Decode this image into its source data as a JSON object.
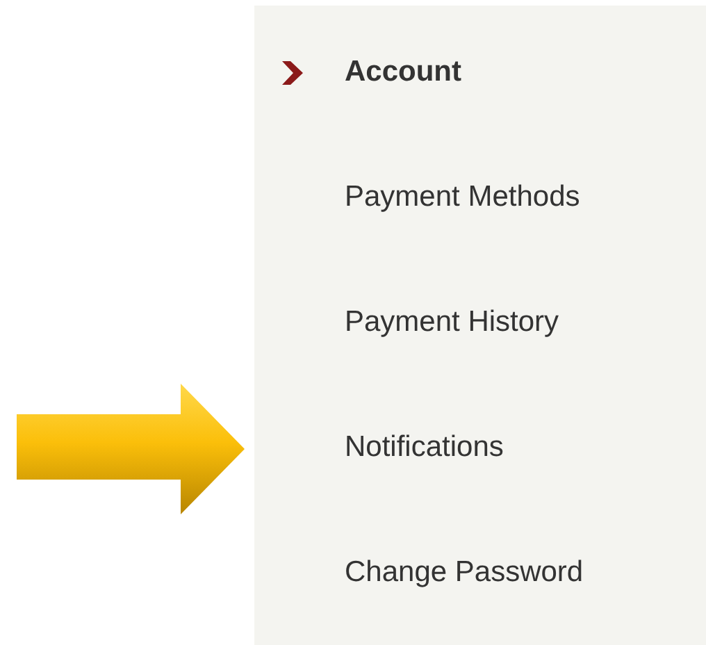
{
  "menu": {
    "items": [
      {
        "label": "Account",
        "selected": true
      },
      {
        "label": "Payment Methods",
        "selected": false
      },
      {
        "label": "Payment History",
        "selected": false
      },
      {
        "label": "Notifications",
        "selected": false
      },
      {
        "label": "Change Password",
        "selected": false
      }
    ]
  }
}
